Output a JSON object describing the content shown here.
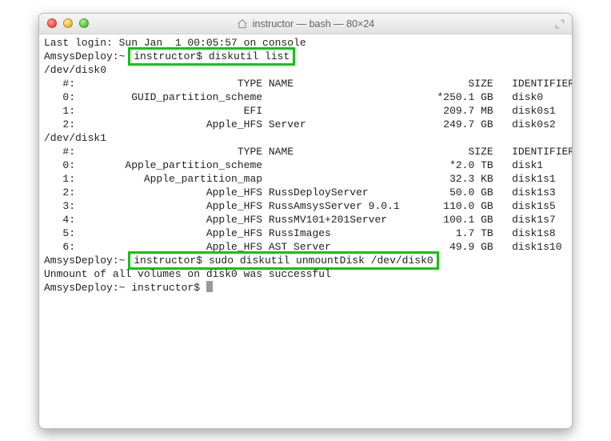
{
  "window": {
    "title": "instructor — bash — 80×24"
  },
  "lastLogin": "Last login: Sun Jan  1 00:05:57 on console",
  "prompt1": {
    "host": "AmsysDeploy:~",
    "user": "instructor$",
    "cmd": "diskutil list"
  },
  "dev0": "/dev/disk0",
  "dev1": "/dev/disk1",
  "header": {
    "idx": "#:",
    "type": "TYPE",
    "name": "NAME",
    "size": "SIZE",
    "idcol": "IDENTIFIER"
  },
  "disk0rows": [
    {
      "idx": "0:",
      "type": "GUID_partition_scheme",
      "name": "",
      "size": "*250.1 GB",
      "id": "disk0"
    },
    {
      "idx": "1:",
      "type": "EFI",
      "name": "",
      "size": "209.7 MB",
      "id": "disk0s1"
    },
    {
      "idx": "2:",
      "type": "Apple_HFS",
      "name": "Server",
      "size": "249.7 GB",
      "id": "disk0s2"
    }
  ],
  "disk1rows": [
    {
      "idx": "0:",
      "type": "Apple_partition_scheme",
      "name": "",
      "size": "*2.0 TB",
      "id": "disk1"
    },
    {
      "idx": "1:",
      "type": "Apple_partition_map",
      "name": "",
      "size": "32.3 KB",
      "id": "disk1s1"
    },
    {
      "idx": "2:",
      "type": "Apple_HFS",
      "name": "RussDeployServer",
      "size": "50.0 GB",
      "id": "disk1s3"
    },
    {
      "idx": "3:",
      "type": "Apple_HFS",
      "name": "RussAmsysServer 9.0.1",
      "size": "110.0 GB",
      "id": "disk1s5"
    },
    {
      "idx": "4:",
      "type": "Apple_HFS",
      "name": "RussMV101+201Server",
      "size": "100.1 GB",
      "id": "disk1s7"
    },
    {
      "idx": "5:",
      "type": "Apple_HFS",
      "name": "RussImages",
      "size": "1.7 TB",
      "id": "disk1s8"
    },
    {
      "idx": "6:",
      "type": "Apple_HFS",
      "name": "AST Server",
      "size": "49.9 GB",
      "id": "disk1s10"
    }
  ],
  "prompt2": {
    "host": "AmsysDeploy:~",
    "user": "instructor$",
    "cmd": "sudo diskutil unmountDisk /dev/disk0"
  },
  "result": "Unmount of all volumes on disk0 was successful",
  "prompt3": {
    "host": "AmsysDeploy:~",
    "user": "instructor$"
  }
}
